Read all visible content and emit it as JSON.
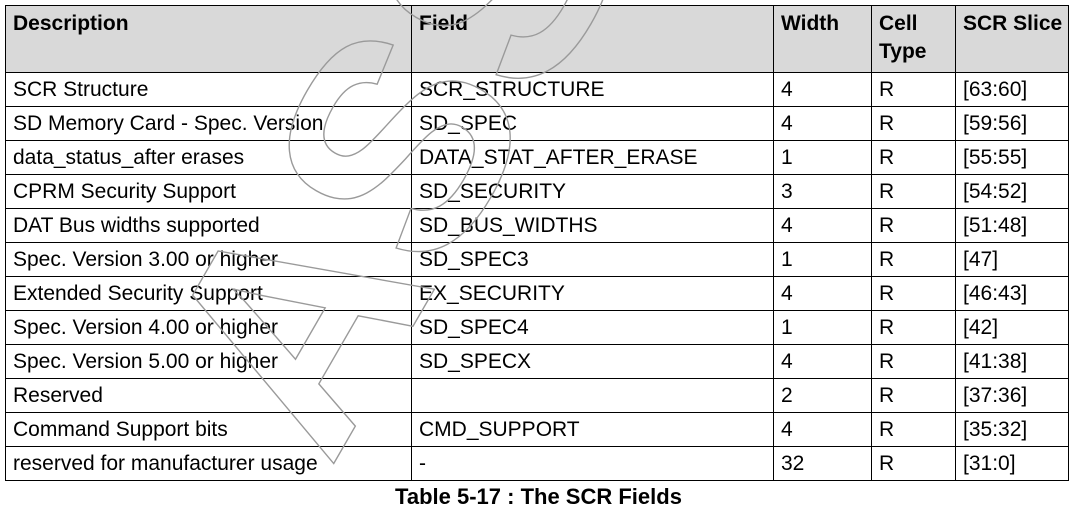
{
  "table": {
    "headers": {
      "description": "Description",
      "field": "Field",
      "width": "Width",
      "cell_type": "Cell Type",
      "scr_slice": "SCR Slice"
    },
    "rows": [
      {
        "description": "SCR Structure",
        "field": "SCR_STRUCTURE",
        "width": "4",
        "cell_type": "R",
        "scr_slice": "[63:60]"
      },
      {
        "description": "SD Memory Card - Spec. Version",
        "field": "SD_SPEC",
        "width": "4",
        "cell_type": "R",
        "scr_slice": "[59:56]"
      },
      {
        "description": "data_status_after erases",
        "field": "DATA_STAT_AFTER_ERASE",
        "width": "1",
        "cell_type": "R",
        "scr_slice": "[55:55]"
      },
      {
        "description": "CPRM Security Support",
        "field": "SD_SECURITY",
        "width": "3",
        "cell_type": "R",
        "scr_slice": "[54:52]"
      },
      {
        "description": "DAT Bus widths supported",
        "field": "SD_BUS_WIDTHS",
        "width": "4",
        "cell_type": "R",
        "scr_slice": "[51:48]"
      },
      {
        "description": "Spec. Version 3.00 or higher",
        "field": "SD_SPEC3",
        "width": "1",
        "cell_type": "R",
        "scr_slice": "[47]"
      },
      {
        "description": "Extended Security Support",
        "field": "EX_SECURITY",
        "width": "4",
        "cell_type": "R",
        "scr_slice": "[46:43]"
      },
      {
        "description": "Spec. Version 4.00 or higher",
        "field": "SD_SPEC4",
        "width": "1",
        "cell_type": "R",
        "scr_slice": "[42]"
      },
      {
        "description": "Spec. Version 5.00 or higher",
        "field": "SD_SPECX",
        "width": "4",
        "cell_type": "R",
        "scr_slice": "[41:38]"
      },
      {
        "description": "Reserved",
        "field": "",
        "width": "2",
        "cell_type": "R",
        "scr_slice": "[37:36]"
      },
      {
        "description": "Command Support bits",
        "field": "CMD_SUPPORT",
        "width": "4",
        "cell_type": "R",
        "scr_slice": "[35:32]"
      },
      {
        "description": "reserved for manufacturer usage",
        "field": "-",
        "width": "32",
        "cell_type": "R",
        "scr_slice": "[31:0]"
      }
    ]
  },
  "caption": "Table 5-17 : The SCR Fields",
  "watermark": "ASSOC",
  "colors": {
    "header_background": "#d9d9d9",
    "border": "#000000",
    "watermark_outline": "#9a9a9a"
  }
}
